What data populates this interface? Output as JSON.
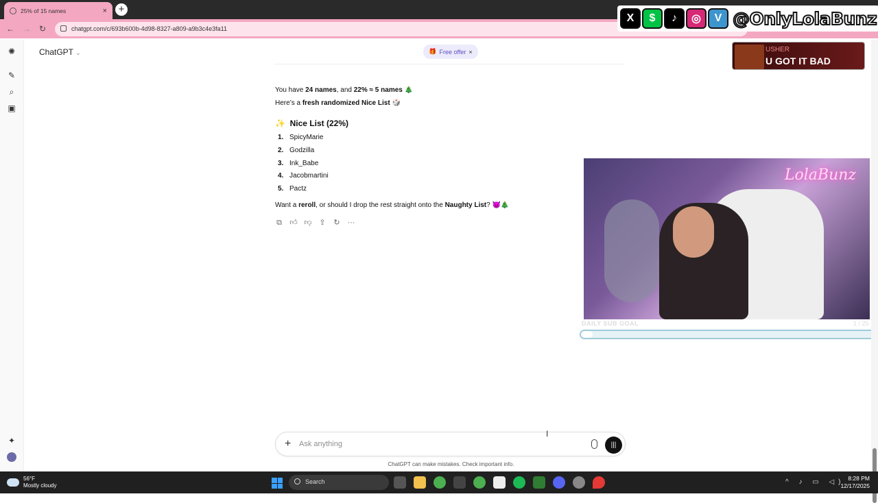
{
  "browser": {
    "tab_title": "25% of 15 names",
    "url": "chatgpt.com/c/693b600b-4d98-8327-a809-a9b3c4e3fa11",
    "theme_color": "#f4a7c1"
  },
  "app": {
    "model_label": "ChatGPT",
    "offer_label": "Free offer"
  },
  "overlay": {
    "social_handle": "@OnlyLolaBunz",
    "social_icons": [
      "x-icon",
      "cashapp-icon",
      "tiktok-icon",
      "instagram-icon",
      "venmo-icon"
    ],
    "now_playing_artist": "USHER",
    "now_playing_title": "U GOT IT BAD",
    "cam_sign": "LolaBunz",
    "goal_label": "DAILY SUB GOAL",
    "goal_count": "1 / 25",
    "goal_progress": 0.04
  },
  "conversation": {
    "line1_pre": "You have ",
    "line1_b1": "24 names",
    "line1_mid": ", and ",
    "line1_b2": "22% ≈ 5 names",
    "line1_emoji": "🎄",
    "line2_pre": "Here’s a ",
    "line2_b": "fresh randomized Nice List",
    "line2_emoji": "🎲",
    "heading_emoji": "✨",
    "heading": "Nice List (22%)",
    "list": [
      {
        "num": "1.",
        "name": "SpicyMarie"
      },
      {
        "num": "2.",
        "name": "Godzilla"
      },
      {
        "num": "3.",
        "name": "Ink_Babe"
      },
      {
        "num": "4.",
        "name": "Jacobmartini"
      },
      {
        "num": "5.",
        "name": "Pactz"
      }
    ],
    "closing_pre": "Want a ",
    "closing_b1": "reroll",
    "closing_mid": ", or should I drop the rest straight onto the ",
    "closing_b2": "Naughty List",
    "closing_end": "? 😈🎄"
  },
  "composer": {
    "placeholder": "Ask anything",
    "disclaimer": "ChatGPT can make mistakes. Check important info."
  },
  "taskbar": {
    "temp": "56°F",
    "weather": "Mostly cloudy",
    "search": "Search",
    "time": "8:28 PM",
    "date": "12/17/2025"
  }
}
